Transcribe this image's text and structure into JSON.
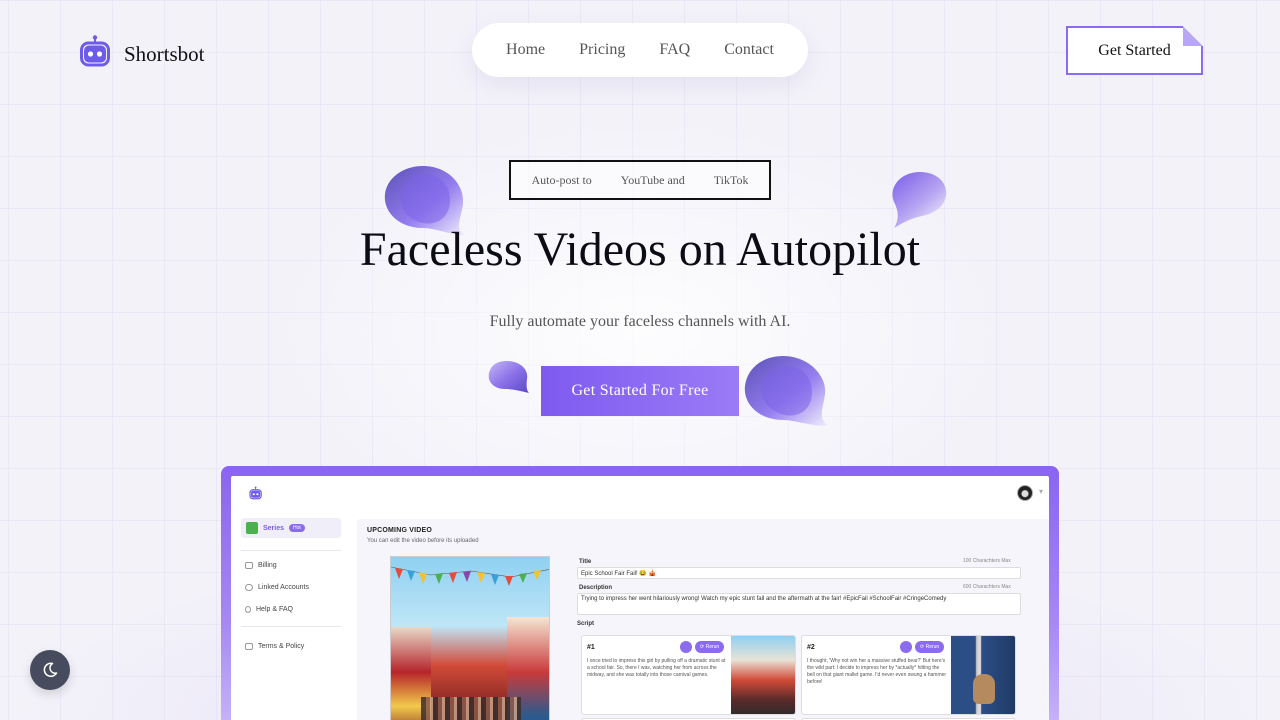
{
  "brand": {
    "name": "Shortsbot",
    "accent": "#8b6cf0"
  },
  "nav": {
    "items": [
      "Home",
      "Pricing",
      "FAQ",
      "Contact"
    ]
  },
  "header": {
    "cta_label": "Get Started"
  },
  "hero": {
    "pill_parts": [
      "Auto-post to",
      "YouTube and",
      "TikTok"
    ],
    "title": "Faceless Videos on Autopilot",
    "subtitle": "Fully automate your faceless channels with AI.",
    "cta_label": "Get Started For Free"
  },
  "preview": {
    "sidebar": {
      "active_label": "Series",
      "active_badge": "Hot",
      "items": [
        "Billing",
        "Linked Accounts",
        "Help & FAQ",
        "Terms & Policy"
      ]
    },
    "main": {
      "section_title": "UPCOMING VIDEO",
      "section_sub": "You can edit the video before its uploaded",
      "title_label": "Title",
      "title_max": "100 Charachters Max",
      "title_value": "Epic School Fair Fail! 😂 🎪",
      "desc_label": "Description",
      "desc_max": "600 Charachters Max",
      "desc_value": "Trying to impress her went hilariously wrong! Watch my epic stunt fail and the aftermath at the fair! #EpicFail #SchoolFair #CringeComedy",
      "script_label": "Script",
      "cards": [
        {
          "num": "#1",
          "text": "I once tried to impress this girl by pulling off a dramatic stunt at a school fair. So, there I was, watching her from across the midway, and she was totally into those carnival games.",
          "rerun": "⟳ Rerun"
        },
        {
          "num": "#2",
          "text": "I thought, 'Why not win her a massive stuffed bear?' But here's the wild part: I decide to impress her by *actually* hitting the bell on that giant mallet game. I'd never even swung a hammer before!",
          "rerun": "⟳ Rerun"
        }
      ]
    }
  },
  "theme_toggle": {
    "icon": "moon-icon"
  }
}
